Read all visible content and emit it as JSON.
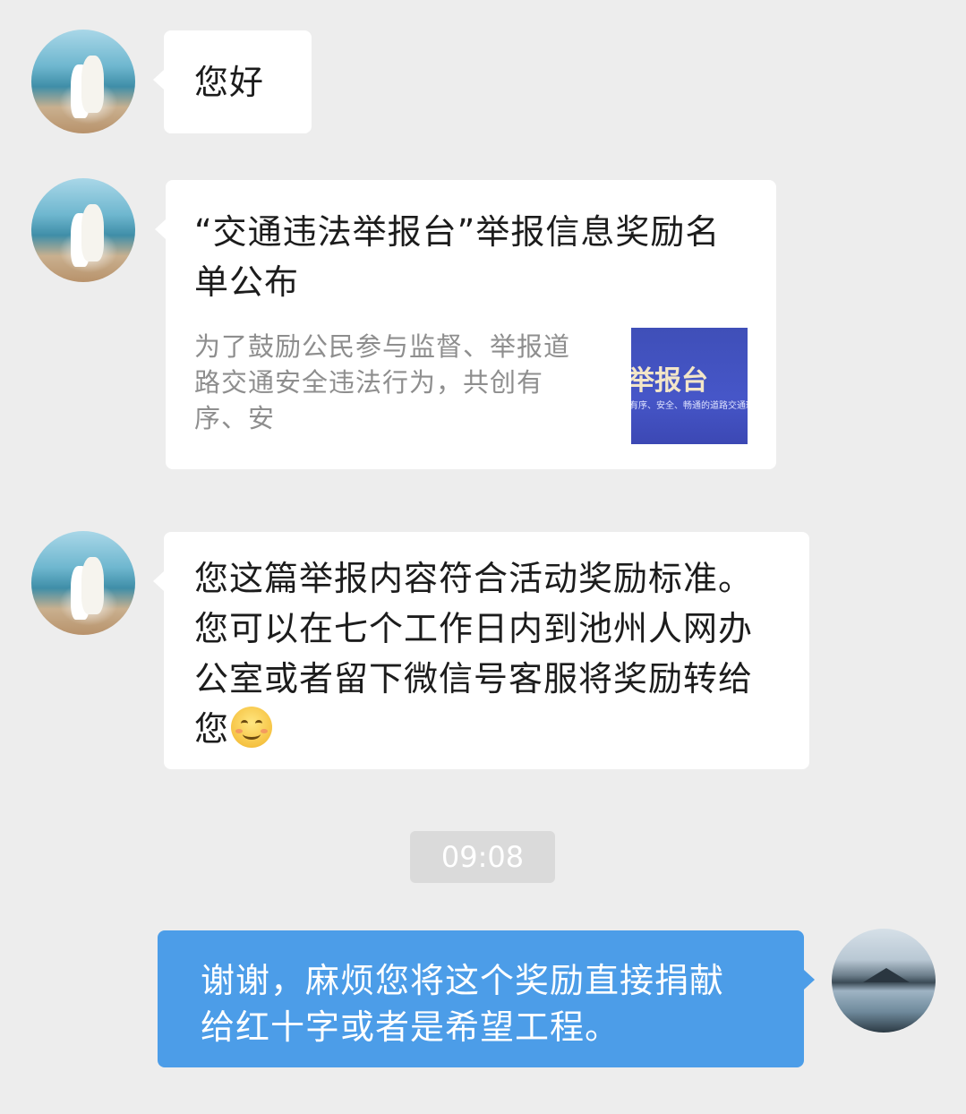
{
  "messages": [
    {
      "text": "您好"
    },
    {
      "link": {
        "title": "“交通违法举报台”举报信息奖励名单公布",
        "description": "为了鼓励公民参与监督、举报道路交通安全违法行为，共创有序、安",
        "thumbnail_title": "举报台",
        "thumbnail_subtitle": "有序、安全、畅通的道路交通环"
      }
    },
    {
      "text": "您这篇举报内容符合活动奖励标准。您可以在七个工作日内到池州人网办公室或者留下微信号客服将奖励转给您",
      "emoji": "smile-emoji"
    },
    {
      "text": "谢谢，麻烦您将这个奖励直接捐献给红十字或者是希望工程。"
    }
  ],
  "timestamp": "09:08",
  "colors": {
    "outgoing_bubble": "#4c9de8",
    "incoming_bubble": "#ffffff",
    "background": "#ededed"
  }
}
